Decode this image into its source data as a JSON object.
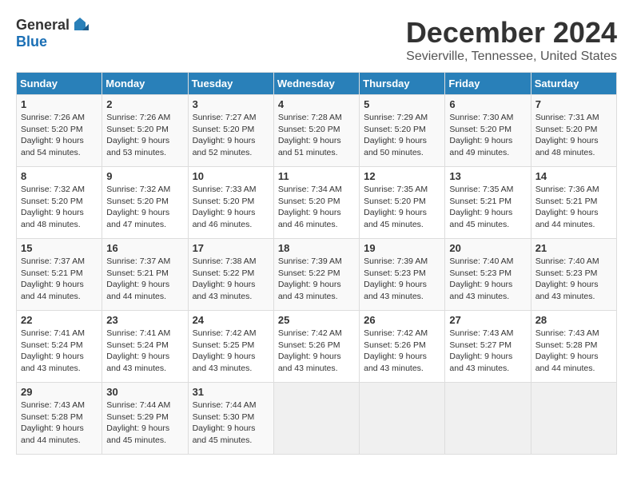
{
  "logo": {
    "general": "General",
    "blue": "Blue"
  },
  "title": "December 2024",
  "location": "Sevierville, Tennessee, United States",
  "days_header": [
    "Sunday",
    "Monday",
    "Tuesday",
    "Wednesday",
    "Thursday",
    "Friday",
    "Saturday"
  ],
  "weeks": [
    [
      {
        "day": "1",
        "sunrise": "Sunrise: 7:26 AM",
        "sunset": "Sunset: 5:20 PM",
        "daylight": "Daylight: 9 hours and 54 minutes."
      },
      {
        "day": "2",
        "sunrise": "Sunrise: 7:26 AM",
        "sunset": "Sunset: 5:20 PM",
        "daylight": "Daylight: 9 hours and 53 minutes."
      },
      {
        "day": "3",
        "sunrise": "Sunrise: 7:27 AM",
        "sunset": "Sunset: 5:20 PM",
        "daylight": "Daylight: 9 hours and 52 minutes."
      },
      {
        "day": "4",
        "sunrise": "Sunrise: 7:28 AM",
        "sunset": "Sunset: 5:20 PM",
        "daylight": "Daylight: 9 hours and 51 minutes."
      },
      {
        "day": "5",
        "sunrise": "Sunrise: 7:29 AM",
        "sunset": "Sunset: 5:20 PM",
        "daylight": "Daylight: 9 hours and 50 minutes."
      },
      {
        "day": "6",
        "sunrise": "Sunrise: 7:30 AM",
        "sunset": "Sunset: 5:20 PM",
        "daylight": "Daylight: 9 hours and 49 minutes."
      },
      {
        "day": "7",
        "sunrise": "Sunrise: 7:31 AM",
        "sunset": "Sunset: 5:20 PM",
        "daylight": "Daylight: 9 hours and 48 minutes."
      }
    ],
    [
      {
        "day": "8",
        "sunrise": "Sunrise: 7:32 AM",
        "sunset": "Sunset: 5:20 PM",
        "daylight": "Daylight: 9 hours and 48 minutes."
      },
      {
        "day": "9",
        "sunrise": "Sunrise: 7:32 AM",
        "sunset": "Sunset: 5:20 PM",
        "daylight": "Daylight: 9 hours and 47 minutes."
      },
      {
        "day": "10",
        "sunrise": "Sunrise: 7:33 AM",
        "sunset": "Sunset: 5:20 PM",
        "daylight": "Daylight: 9 hours and 46 minutes."
      },
      {
        "day": "11",
        "sunrise": "Sunrise: 7:34 AM",
        "sunset": "Sunset: 5:20 PM",
        "daylight": "Daylight: 9 hours and 46 minutes."
      },
      {
        "day": "12",
        "sunrise": "Sunrise: 7:35 AM",
        "sunset": "Sunset: 5:20 PM",
        "daylight": "Daylight: 9 hours and 45 minutes."
      },
      {
        "day": "13",
        "sunrise": "Sunrise: 7:35 AM",
        "sunset": "Sunset: 5:21 PM",
        "daylight": "Daylight: 9 hours and 45 minutes."
      },
      {
        "day": "14",
        "sunrise": "Sunrise: 7:36 AM",
        "sunset": "Sunset: 5:21 PM",
        "daylight": "Daylight: 9 hours and 44 minutes."
      }
    ],
    [
      {
        "day": "15",
        "sunrise": "Sunrise: 7:37 AM",
        "sunset": "Sunset: 5:21 PM",
        "daylight": "Daylight: 9 hours and 44 minutes."
      },
      {
        "day": "16",
        "sunrise": "Sunrise: 7:37 AM",
        "sunset": "Sunset: 5:21 PM",
        "daylight": "Daylight: 9 hours and 44 minutes."
      },
      {
        "day": "17",
        "sunrise": "Sunrise: 7:38 AM",
        "sunset": "Sunset: 5:22 PM",
        "daylight": "Daylight: 9 hours and 43 minutes."
      },
      {
        "day": "18",
        "sunrise": "Sunrise: 7:39 AM",
        "sunset": "Sunset: 5:22 PM",
        "daylight": "Daylight: 9 hours and 43 minutes."
      },
      {
        "day": "19",
        "sunrise": "Sunrise: 7:39 AM",
        "sunset": "Sunset: 5:23 PM",
        "daylight": "Daylight: 9 hours and 43 minutes."
      },
      {
        "day": "20",
        "sunrise": "Sunrise: 7:40 AM",
        "sunset": "Sunset: 5:23 PM",
        "daylight": "Daylight: 9 hours and 43 minutes."
      },
      {
        "day": "21",
        "sunrise": "Sunrise: 7:40 AM",
        "sunset": "Sunset: 5:23 PM",
        "daylight": "Daylight: 9 hours and 43 minutes."
      }
    ],
    [
      {
        "day": "22",
        "sunrise": "Sunrise: 7:41 AM",
        "sunset": "Sunset: 5:24 PM",
        "daylight": "Daylight: 9 hours and 43 minutes."
      },
      {
        "day": "23",
        "sunrise": "Sunrise: 7:41 AM",
        "sunset": "Sunset: 5:24 PM",
        "daylight": "Daylight: 9 hours and 43 minutes."
      },
      {
        "day": "24",
        "sunrise": "Sunrise: 7:42 AM",
        "sunset": "Sunset: 5:25 PM",
        "daylight": "Daylight: 9 hours and 43 minutes."
      },
      {
        "day": "25",
        "sunrise": "Sunrise: 7:42 AM",
        "sunset": "Sunset: 5:26 PM",
        "daylight": "Daylight: 9 hours and 43 minutes."
      },
      {
        "day": "26",
        "sunrise": "Sunrise: 7:42 AM",
        "sunset": "Sunset: 5:26 PM",
        "daylight": "Daylight: 9 hours and 43 minutes."
      },
      {
        "day": "27",
        "sunrise": "Sunrise: 7:43 AM",
        "sunset": "Sunset: 5:27 PM",
        "daylight": "Daylight: 9 hours and 43 minutes."
      },
      {
        "day": "28",
        "sunrise": "Sunrise: 7:43 AM",
        "sunset": "Sunset: 5:28 PM",
        "daylight": "Daylight: 9 hours and 44 minutes."
      }
    ],
    [
      {
        "day": "29",
        "sunrise": "Sunrise: 7:43 AM",
        "sunset": "Sunset: 5:28 PM",
        "daylight": "Daylight: 9 hours and 44 minutes."
      },
      {
        "day": "30",
        "sunrise": "Sunrise: 7:44 AM",
        "sunset": "Sunset: 5:29 PM",
        "daylight": "Daylight: 9 hours and 45 minutes."
      },
      {
        "day": "31",
        "sunrise": "Sunrise: 7:44 AM",
        "sunset": "Sunset: 5:30 PM",
        "daylight": "Daylight: 9 hours and 45 minutes."
      },
      null,
      null,
      null,
      null
    ]
  ]
}
